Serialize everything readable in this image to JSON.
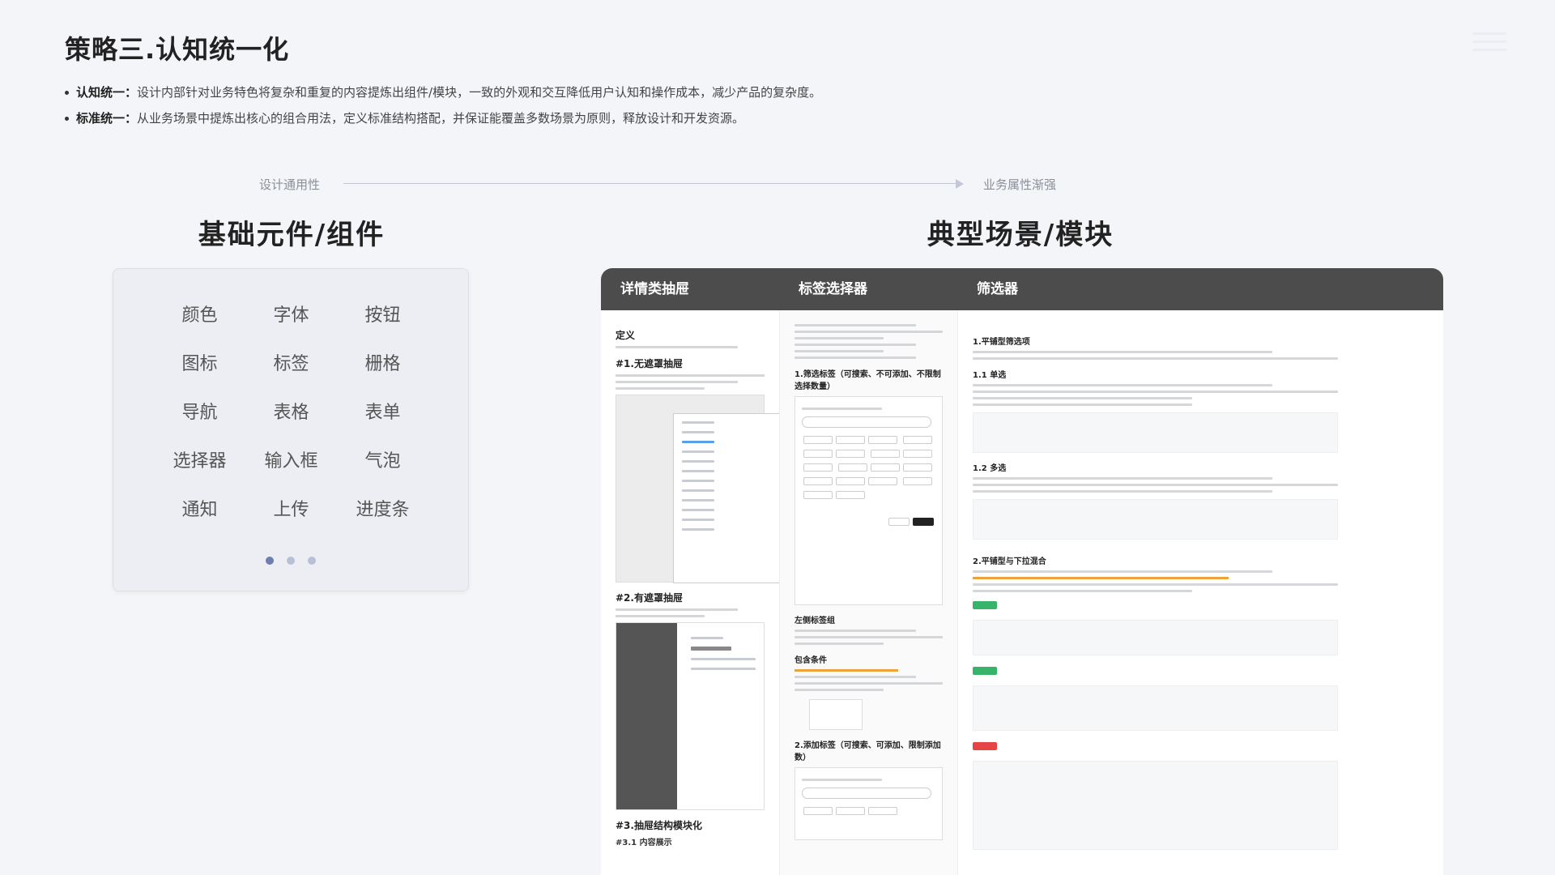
{
  "header": {
    "title": "策略三.认知统一化"
  },
  "bullets": [
    {
      "label": "认知统一：",
      "text": "设计内部针对业务特色将复杂和重复的内容提炼出组件/模块，一致的外观和交互降低用户认知和操作成本，减少产品的复杂度。"
    },
    {
      "label": "标准统一：",
      "text": "从业务场景中提炼出核心的组合用法，定义标准结构搭配，并保证能覆盖多数场景为原则，释放设计和开发资源。"
    }
  ],
  "axis": {
    "left_label": "设计通用性",
    "right_label": "业务属性渐强"
  },
  "left_section": {
    "heading": "基础元件/组件",
    "items": [
      "颜色",
      "字体",
      "按钮",
      "图标",
      "标签",
      "栅格",
      "导航",
      "表格",
      "表单",
      "选择器",
      "输入框",
      "气泡",
      "通知",
      "上传",
      "进度条"
    ],
    "page_dots": {
      "count": 3,
      "active_index": 0
    }
  },
  "right_section": {
    "heading": "典型场景/模块",
    "tabs": [
      "详情类抽屉",
      "标签选择器",
      "筛选器"
    ]
  },
  "drawer_doc": {
    "h_def": "定义",
    "h1": "#1.无遮罩抽屉",
    "h2": "#2.有遮罩抽屉",
    "h3": "#3.抽屉结构模块化",
    "h31": "#3.1 内容展示"
  },
  "tag_doc": {
    "h1": "1.筛选标签（可搜索、不可添加、不限制选择数量）",
    "h_left": "左侧标签组",
    "h_include": "包含条件",
    "h2": "2.添加标签（可搜索、可添加、限制添加数）"
  },
  "filter_doc": {
    "h1": "1.平铺型筛选项",
    "h11": "1.1 单选",
    "h12": "1.2 多选",
    "h2": "2.平铺型与下拉混合"
  },
  "colors": {
    "tab_bar": "#4c4c4c",
    "success_chip": "#38b36a",
    "danger_chip": "#e54545",
    "warning_text": "#f0a23a"
  }
}
